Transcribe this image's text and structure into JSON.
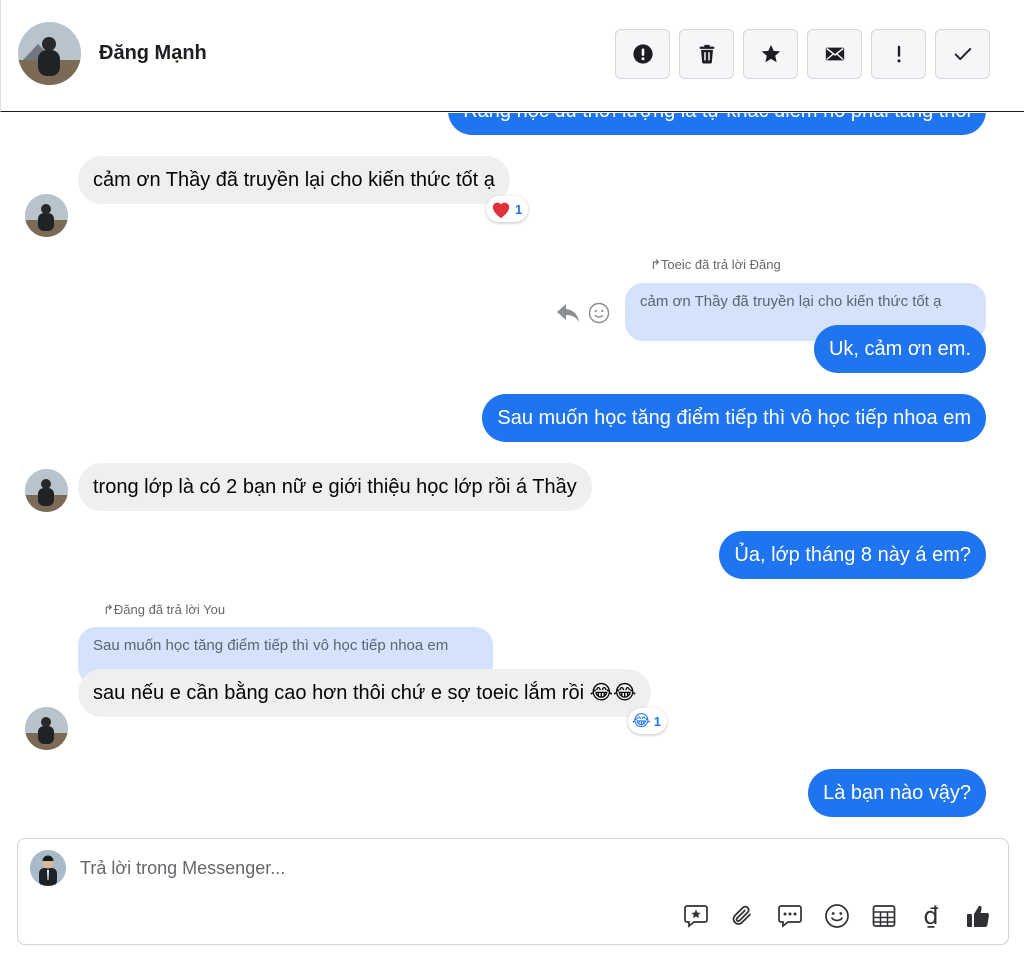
{
  "header": {
    "contact_name": "Đăng Mạnh",
    "toolbar": [
      {
        "name": "spam-button",
        "icon": "alert-circle-icon"
      },
      {
        "name": "delete-button",
        "icon": "trash-icon"
      },
      {
        "name": "star-button",
        "icon": "star-icon"
      },
      {
        "name": "mark-unread-button",
        "icon": "envelope-icon"
      },
      {
        "name": "important-button",
        "icon": "exclamation-icon"
      },
      {
        "name": "done-button",
        "icon": "checkmark-icon"
      }
    ]
  },
  "messages": {
    "m0": "Rảng học đủ thời lượng là tự khắc điểm nó phải tăng thôi",
    "m1": "cảm ơn Thầy đã truyền lại cho kiến thức tốt ạ",
    "m1_reaction_count": "1",
    "m2_reply_note": "Toeic đã trả lời Đăng",
    "m2_quote": "cảm ơn Thầy đã truyền lại cho kiến thức tốt ạ",
    "m2": "Uk, cảm ơn em.",
    "m3": "Sau muốn học tăng điểm tiếp thì vô học tiếp nhoa em",
    "m4": "trong lớp là có 2 bạn nữ e giới thiệu học lớp rồi á Thầy",
    "m5": "Ủa, lớp tháng 8 này á em?",
    "m6_reply_note": "Đăng đã trả lời You",
    "m6_quote": "Sau muốn học tăng điểm tiếp thì vô học tiếp nhoa em",
    "m6": "sau nếu e cần bằng cao hơn thôi chứ e sợ toeic lắm rồi 😂😂",
    "m6_reaction_count": "1",
    "m7": "Là bạn nào vậy?"
  },
  "composer": {
    "placeholder": "Trả lời trong Messenger...",
    "tools": [
      "sticker-icon",
      "attach-icon",
      "saved-reply-icon",
      "emoji-icon",
      "table-icon",
      "payment-icon",
      "like-icon"
    ],
    "currency_symbol": "₫"
  },
  "colors": {
    "outgoing": "#1f75ef",
    "incoming": "#eeeff1",
    "quote": "#d4e2fb"
  }
}
